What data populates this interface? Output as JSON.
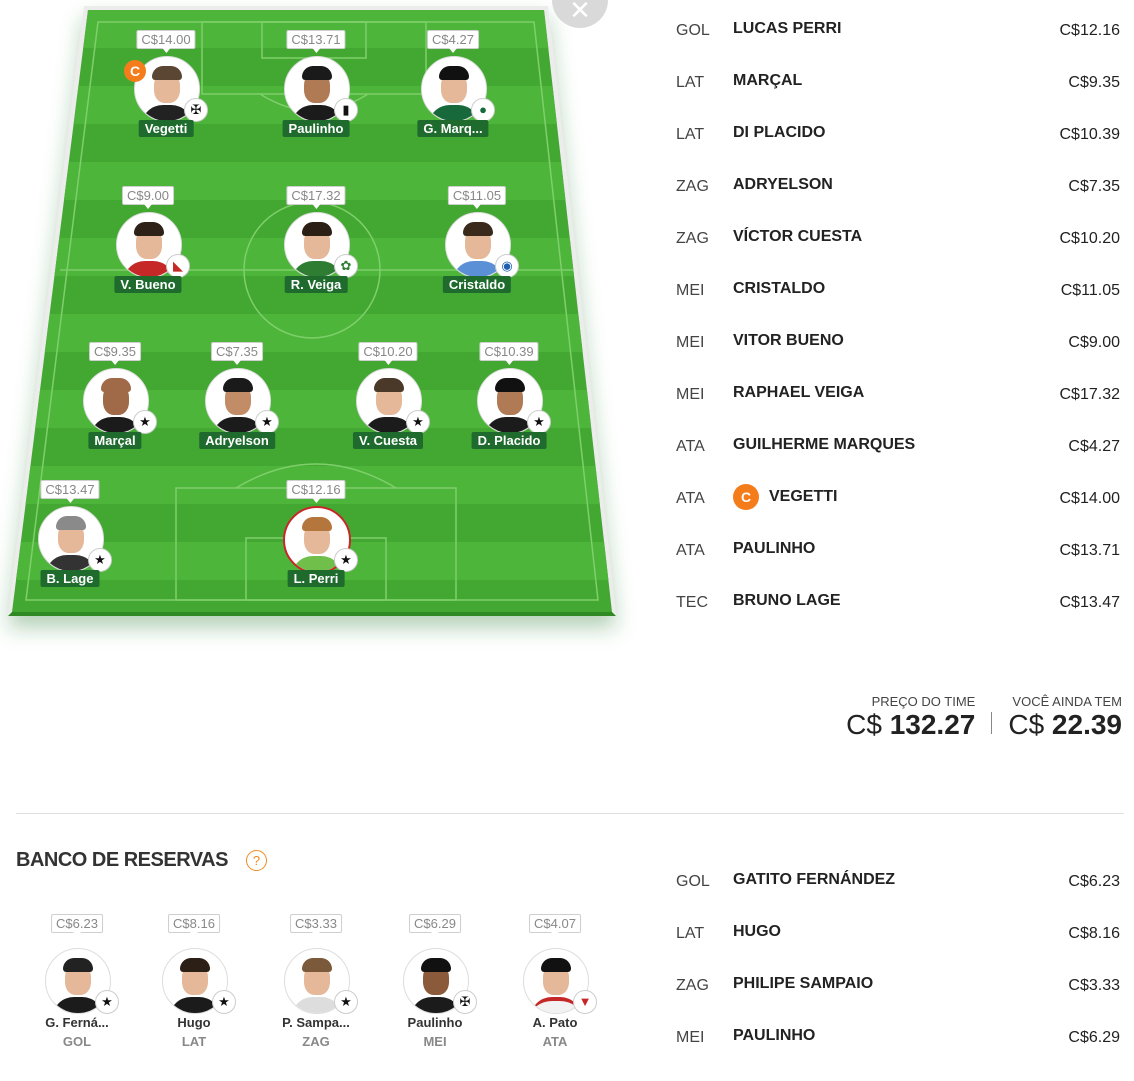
{
  "close_icon": "close-icon",
  "field_players": [
    {
      "name": "Vegetti",
      "price": "C$14.00",
      "captain": true,
      "captain_label": "C",
      "shield": "vasco-shield-icon"
    },
    {
      "name": "Paulinho",
      "price": "C$13.71",
      "shield": "atletico-mg-shield-icon"
    },
    {
      "name": "G. Marq...",
      "price": "C$4.27",
      "shield": "goias-shield-icon"
    },
    {
      "name": "V. Bueno",
      "price": "C$9.00",
      "shield": "athletico-pr-shield-icon"
    },
    {
      "name": "R. Veiga",
      "price": "C$17.32",
      "shield": "palmeiras-shield-icon"
    },
    {
      "name": "Cristaldo",
      "price": "C$11.05",
      "shield": "gremio-shield-icon"
    },
    {
      "name": "Marçal",
      "price": "C$9.35",
      "shield": "botafogo-shield-icon"
    },
    {
      "name": "Adryelson",
      "price": "C$7.35",
      "shield": "botafogo-shield-icon"
    },
    {
      "name": "V. Cuesta",
      "price": "C$10.20",
      "shield": "botafogo-shield-icon"
    },
    {
      "name": "D. Placido",
      "price": "C$10.39",
      "shield": "botafogo-shield-icon"
    },
    {
      "name": "B. Lage",
      "price": "C$13.47",
      "shield": "botafogo-shield-icon"
    },
    {
      "name": "L. Perri",
      "price": "C$12.16",
      "shield": "botafogo-shield-icon"
    }
  ],
  "lineup": [
    {
      "pos": "GOL",
      "name": "LUCAS PERRI",
      "price": "C$12.16"
    },
    {
      "pos": "LAT",
      "name": "MARÇAL",
      "price": "C$9.35"
    },
    {
      "pos": "LAT",
      "name": "DI PLACIDO",
      "price": "C$10.39"
    },
    {
      "pos": "ZAG",
      "name": "ADRYELSON",
      "price": "C$7.35"
    },
    {
      "pos": "ZAG",
      "name": "VÍCTOR CUESTA",
      "price": "C$10.20"
    },
    {
      "pos": "MEI",
      "name": "CRISTALDO",
      "price": "C$11.05"
    },
    {
      "pos": "MEI",
      "name": "VITOR BUENO",
      "price": "C$9.00"
    },
    {
      "pos": "MEI",
      "name": "RAPHAEL VEIGA",
      "price": "C$17.32"
    },
    {
      "pos": "ATA",
      "name": "GUILHERME MARQUES",
      "price": "C$4.27"
    },
    {
      "pos": "ATA",
      "name": "VEGETTI",
      "price": "C$14.00",
      "captain_label": "C"
    },
    {
      "pos": "ATA",
      "name": "PAULINHO",
      "price": "C$13.71"
    },
    {
      "pos": "TEC",
      "name": "BRUNO LAGE",
      "price": "C$13.47"
    }
  ],
  "summary": {
    "team_price_label": "PREÇO DO TIME",
    "team_price_currency": "C$",
    "team_price_value": "132.27",
    "remaining_label": "VOCÊ AINDA TEM",
    "remaining_currency": "C$",
    "remaining_value": "22.39"
  },
  "bench": {
    "title": "BANCO DE RESERVAS",
    "help_label": "?",
    "players": [
      {
        "name": "G. Ferná...",
        "price": "C$6.23",
        "pos": "GOL",
        "shield": "botafogo-shield-icon"
      },
      {
        "name": "Hugo",
        "price": "C$8.16",
        "pos": "LAT",
        "shield": "botafogo-shield-icon"
      },
      {
        "name": "P. Sampa...",
        "price": "C$3.33",
        "pos": "ZAG",
        "shield": "botafogo-shield-icon"
      },
      {
        "name": "Paulinho",
        "price": "C$6.29",
        "pos": "MEI",
        "shield": "vasco-shield-icon"
      },
      {
        "name": "A. Pato",
        "price": "C$4.07",
        "pos": "ATA",
        "shield": "sao-paulo-shield-icon"
      }
    ],
    "list": [
      {
        "pos": "GOL",
        "name": "GATITO FERNÁNDEZ",
        "price": "C$6.23"
      },
      {
        "pos": "LAT",
        "name": "HUGO",
        "price": "C$8.16"
      },
      {
        "pos": "ZAG",
        "name": "PHILIPE SAMPAIO",
        "price": "C$3.33"
      },
      {
        "pos": "MEI",
        "name": "PAULINHO",
        "price": "C$6.29"
      }
    ]
  }
}
